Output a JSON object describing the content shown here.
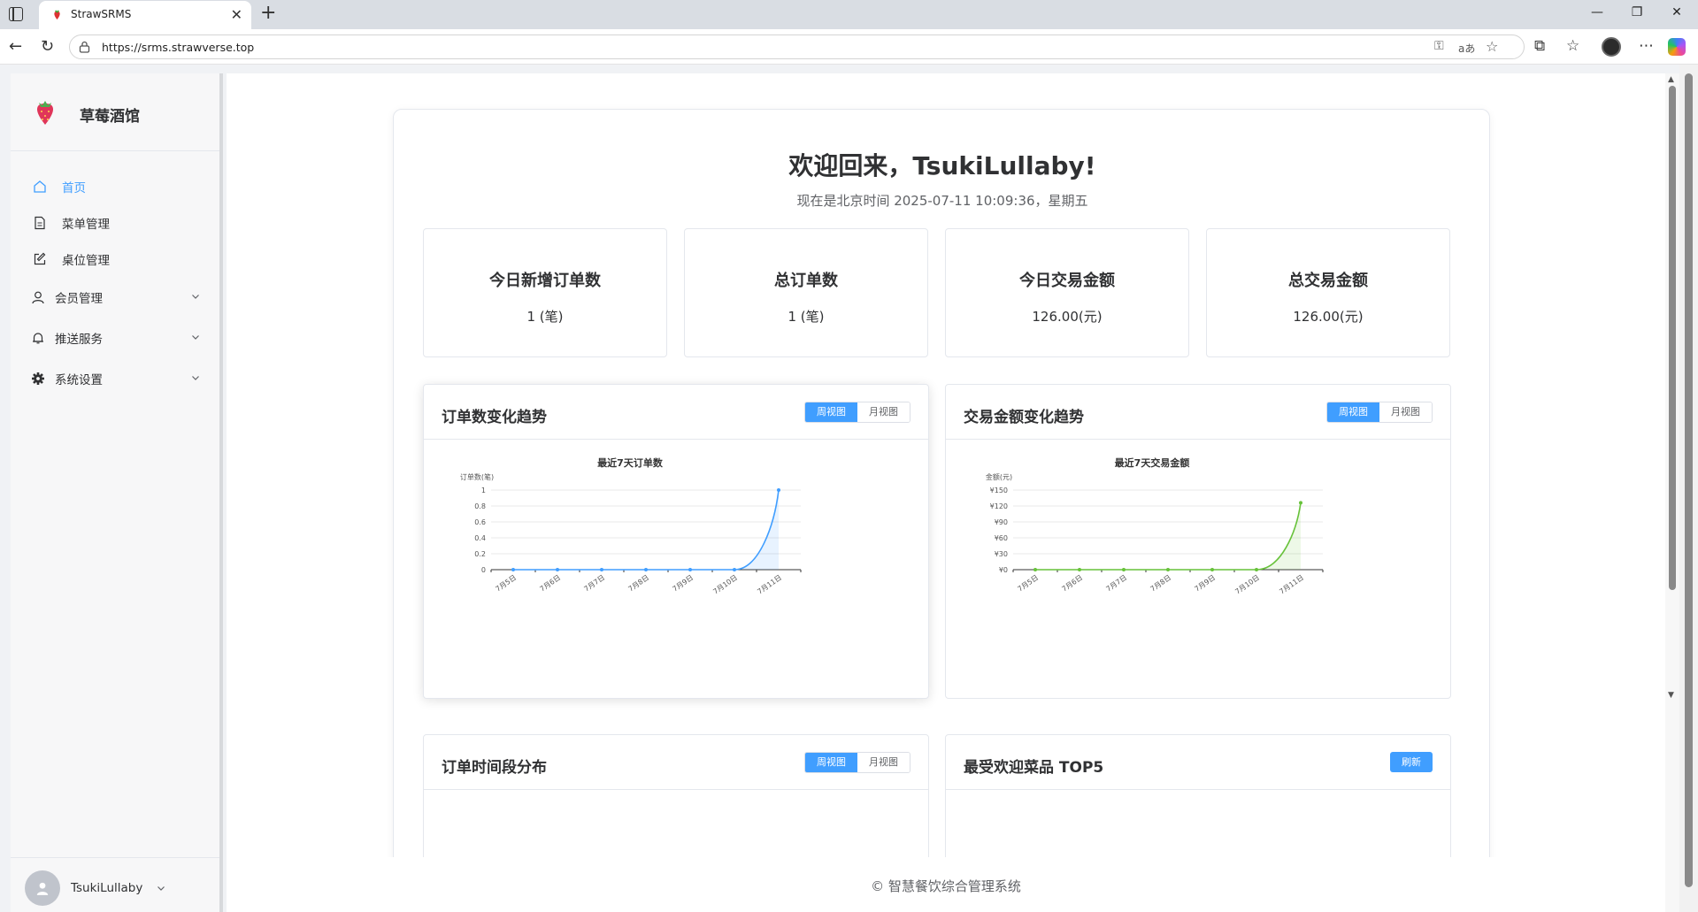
{
  "browser": {
    "tab_title": "StrawSRMS",
    "url": "https://srms.strawverse.top",
    "new_tab_symbol": "+",
    "close_symbol": "✕"
  },
  "sidebar": {
    "brand": "草莓酒馆",
    "items": [
      {
        "label": "首页",
        "icon": "home-icon",
        "active": true
      },
      {
        "label": "菜单管理",
        "icon": "document-icon"
      },
      {
        "label": "桌位管理",
        "icon": "edit-icon"
      },
      {
        "label": "会员管理",
        "icon": "user-icon",
        "submenu": true
      },
      {
        "label": "推送服务",
        "icon": "bell-icon",
        "submenu": true
      },
      {
        "label": "系统设置",
        "icon": "gear-icon",
        "submenu": true
      }
    ],
    "user": "TsukiLullaby"
  },
  "dashboard": {
    "welcome": "欢迎回来，TsukiLullaby!",
    "time_line": "现在是北京时间 2025-07-11 10:09:36，星期五",
    "stats": [
      {
        "label": "今日新增订单数",
        "value": "1 (笔)"
      },
      {
        "label": "总订单数",
        "value": "1 (笔)"
      },
      {
        "label": "今日交易金额",
        "value": "126.00(元)"
      },
      {
        "label": "总交易金额",
        "value": "126.00(元)"
      }
    ],
    "panels": {
      "orders_trend": {
        "title": "订单数变化趋势",
        "week": "周视图",
        "month": "月视图"
      },
      "amount_trend": {
        "title": "交易金额变化趋势",
        "week": "周视图",
        "month": "月视图"
      },
      "time_dist": {
        "title": "订单时间段分布",
        "week": "周视图",
        "month": "月视图"
      },
      "top5": {
        "title": "最受欢迎菜品 TOP5",
        "refresh": "刷新"
      }
    },
    "footer": "© 智慧餐饮综合管理系统"
  },
  "colors": {
    "primary": "#409eff",
    "green": "#67c23a"
  },
  "chart_data": [
    {
      "type": "line",
      "title": "最近7天订单数",
      "ylabel": "订单数(笔)",
      "categories": [
        "7月5日",
        "7月6日",
        "7月7日",
        "7月8日",
        "7月9日",
        "7月10日",
        "7月11日"
      ],
      "values": [
        0,
        0,
        0,
        0,
        0,
        0,
        1
      ],
      "ylim": [
        0,
        1
      ],
      "yticks": [
        "0",
        "0.2",
        "0.4",
        "0.6",
        "0.8",
        "1"
      ],
      "color": "#409eff"
    },
    {
      "type": "line",
      "title": "最近7天交易金额",
      "ylabel": "金额(元)",
      "categories": [
        "7月5日",
        "7月6日",
        "7月7日",
        "7月8日",
        "7月9日",
        "7月10日",
        "7月11日"
      ],
      "values": [
        0,
        0,
        0,
        0,
        0,
        0,
        126
      ],
      "ylim": [
        0,
        150
      ],
      "yticks": [
        "¥0",
        "¥30",
        "¥60",
        "¥90",
        "¥120",
        "¥150"
      ],
      "color": "#67c23a"
    }
  ]
}
